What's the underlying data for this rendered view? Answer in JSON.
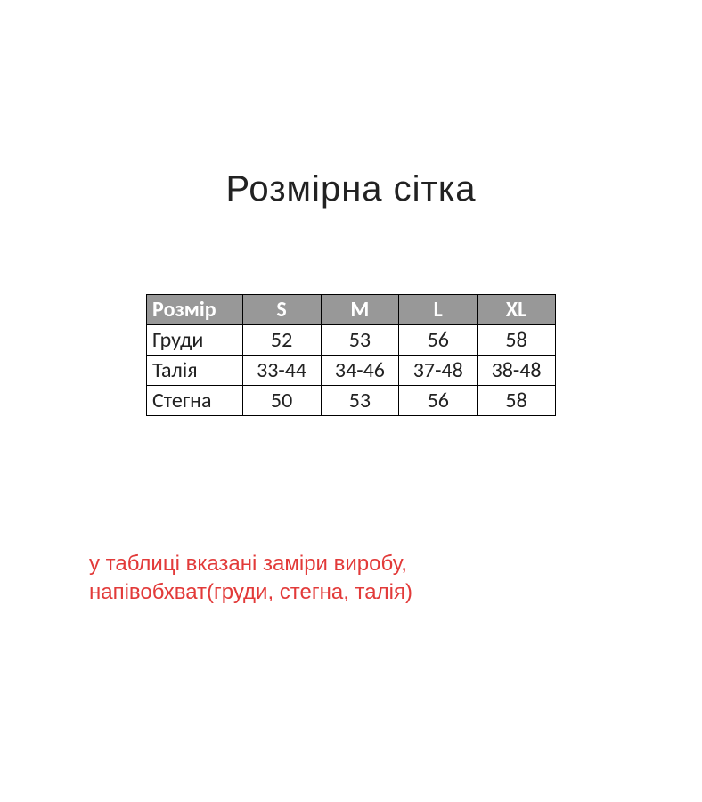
{
  "title": "Розмірна сітка",
  "chart_data": {
    "type": "table",
    "columns": [
      "Розмір",
      "S",
      "M",
      "L",
      "XL"
    ],
    "rows": [
      {
        "label": "Груди",
        "values": [
          "52",
          "53",
          "56",
          "58"
        ]
      },
      {
        "label": "Талія",
        "values": [
          "33-44",
          "34-46",
          "37-48",
          "38-48"
        ]
      },
      {
        "label": "Стегна",
        "values": [
          "50",
          "53",
          "56",
          "58"
        ]
      }
    ]
  },
  "note": "у таблиці вказані заміри виробу, напівобхват(груди, стегна, талія)"
}
